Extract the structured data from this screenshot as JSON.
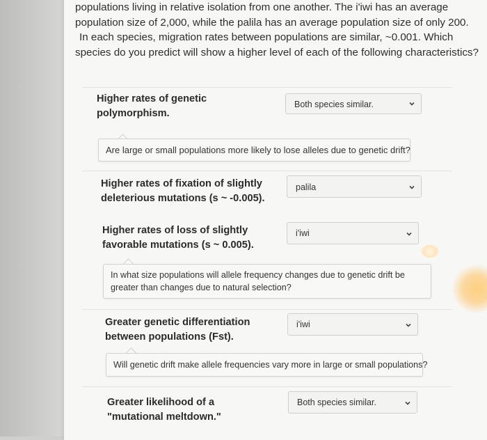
{
  "intro_lines": [
    "populations living in relative isolation from one another. The i'iwi has an average",
    "population size of 2,000, while the palila has an average population size of only 200.",
    "In each species, migration rates between populations are similar, ~0.001. Which",
    "species do you predict will show a higher level of each of the following characteristics?"
  ],
  "rows": [
    {
      "label": [
        "Higher rates of genetic",
        "polymorphism."
      ],
      "answer": "Both species similar."
    },
    {
      "label": [
        "Higher rates of fixation of slightly",
        "deleterious mutations (s ~ -0.005)."
      ],
      "answer": "palila"
    },
    {
      "label": [
        "Higher rates of loss of slightly",
        "favorable mutations (s ~ 0.005)."
      ],
      "answer": "i'iwi"
    },
    {
      "label": [
        "Greater genetic differentiation",
        "between populations (Fst)."
      ],
      "answer": "i'iwi"
    },
    {
      "label": [
        "Greater likelihood of a",
        "\"mutational meltdown.\""
      ],
      "answer": "Both species similar."
    }
  ],
  "hints": [
    "Are large or small populations more likely to lose alleles due to genetic drift?",
    "In what size populations will allele frequency changes due to genetic drift be greater than changes due to natural selection?",
    "Will genetic drift make allele frequencies vary more in large or small populations?"
  ],
  "icons": {
    "dropdown": "chevron-down-icon"
  }
}
